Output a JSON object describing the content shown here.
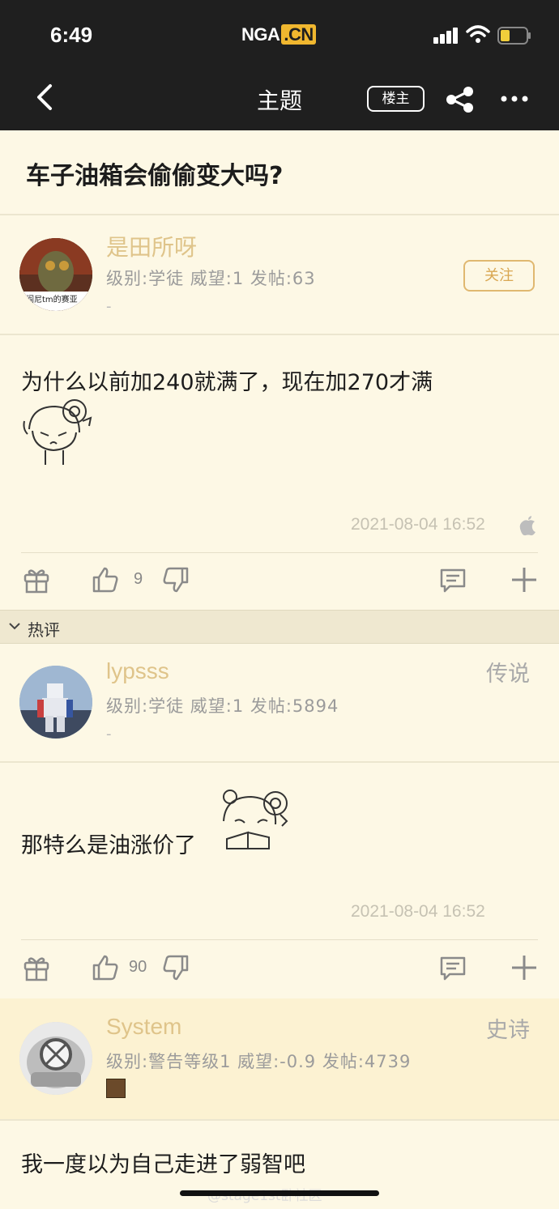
{
  "status_bar": {
    "time": "6:49",
    "logo_main": "NGA",
    "logo_suffix": ".CN"
  },
  "nav": {
    "title": "主题",
    "louzhu_label": "楼主"
  },
  "topic": {
    "title": "车子油箱会偷偷变大吗?"
  },
  "post1": {
    "username": "是田所呀",
    "avatar_caption": "阎尼tm的赛亚",
    "meta": "级别:学徒  威望:1  发帖:63",
    "dash": "-",
    "follow_label": "关注",
    "content": "为什么以前加240就满了，现在加270才满",
    "date": "2021-08-04 16:52",
    "likes": "9"
  },
  "hot_section": {
    "label": "热评"
  },
  "post2": {
    "username": "lypsss",
    "rank": "传说",
    "meta": "级别:学徒  威望:1  发帖:5894",
    "dash": "-",
    "content": "那特么是油涨价了",
    "date": "2021-08-04 16:52",
    "likes": "90"
  },
  "post3": {
    "username": "System",
    "rank": "史诗",
    "meta": "级别:警告等级1  威望:-0.9  发帖:4739",
    "content": "我一度以为自己走进了弱智吧"
  },
  "watermark": "@stage1st卧社区",
  "colors": {
    "accent": "#dfc48a",
    "background": "#fdf8e5",
    "topbar": "#1f1f1f"
  }
}
